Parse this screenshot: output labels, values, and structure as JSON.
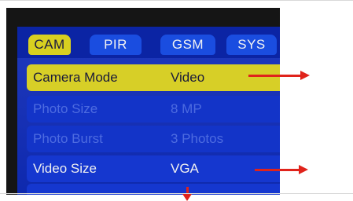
{
  "tabs": [
    {
      "label": "CAM",
      "active": true
    },
    {
      "label": "PIR",
      "active": false
    },
    {
      "label": "GSM",
      "active": false
    },
    {
      "label": "SYS",
      "active": false
    }
  ],
  "menu": [
    {
      "label": "Camera Mode",
      "value": "Video",
      "state": "selected"
    },
    {
      "label": "Photo Size",
      "value": "8 MP",
      "state": "disabled"
    },
    {
      "label": "Photo Burst",
      "value": "3 Photos",
      "state": "disabled"
    },
    {
      "label": "Video Size",
      "value": "VGA",
      "state": "normal"
    }
  ],
  "annotations": {
    "arrow_color": "#e0231b",
    "arrows_point_to": [
      "camera-mode-row",
      "video-size-row",
      "next-row-below"
    ]
  },
  "colors": {
    "screen_bg": "#0f2bb8",
    "row_bg": "#1537cf",
    "highlight": "#d7cf27",
    "tab_bg": "#1a4de0"
  }
}
